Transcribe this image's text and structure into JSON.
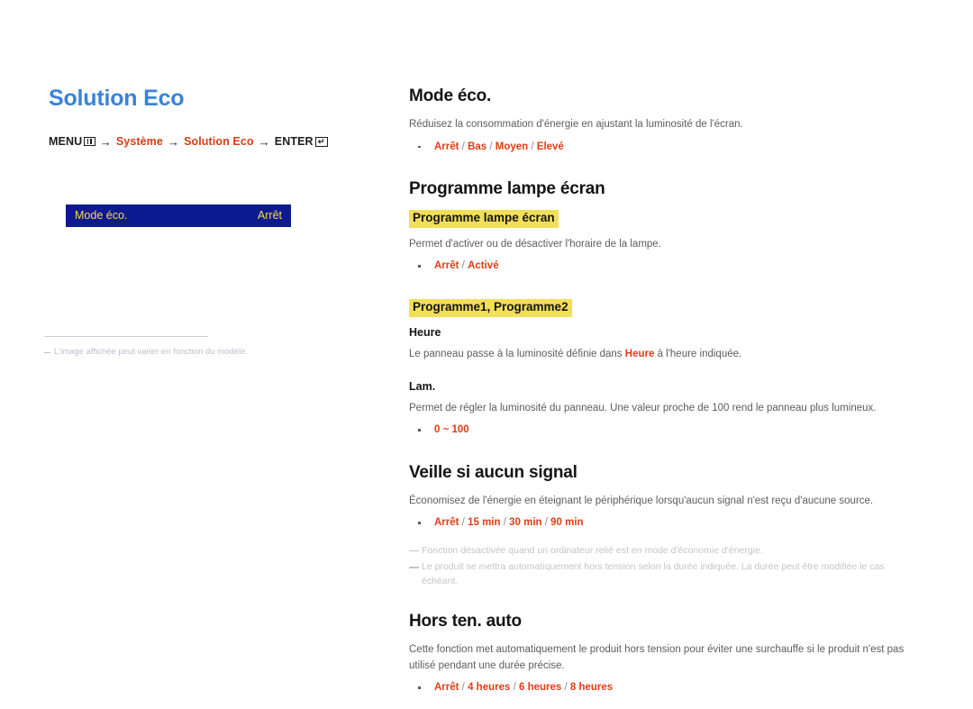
{
  "page": {
    "title": "Solution Eco"
  },
  "breadcrumb": {
    "menu_label": "MENU",
    "menu_icon": "menu-grid-icon",
    "arrow": "→",
    "step1": "Système",
    "step2": "Solution Eco",
    "enter_label": "ENTER",
    "enter_icon": "enter-return-icon",
    "enter_glyph": "↵"
  },
  "osd": {
    "label": "Mode éco.",
    "value": "Arrêt",
    "bg_color": "#0d1a8f",
    "text_color": "#ffd94a"
  },
  "left_note": {
    "text": "L'image affichée peut varier en fonction du modèle."
  },
  "colors": {
    "title_blue": "#3b82d8",
    "accent_orange": "#e03c16",
    "highlight_yellow": "#f2df58",
    "body_gray": "#5c5c5c"
  },
  "sections": [
    {
      "title": "Mode éco.",
      "body": "Réduisez la consommation d'énergie en ajustant la luminosité de l'écran.",
      "options": [
        "Arrêt",
        "Bas",
        "Moyen",
        "Elevé"
      ]
    },
    {
      "title": "Programme lampe écran",
      "highlight_head_1": "Programme lampe écran",
      "body_1": "Permet d'activer ou de désactiver l'horaire de la lampe.",
      "options_1": [
        "Arrêt",
        "Activé"
      ],
      "highlight_head_2": "Programme1, Programme2",
      "sub_head_1": "Heure",
      "body_2_pre": "Le panneau passe à la luminosité définie dans ",
      "body_2_hl": "Heure",
      "body_2_post": " à l'heure indiquée.",
      "sub_head_2": "Lam.",
      "body_3": "Permet de régler la luminosité du panneau. Une valeur proche de 100 rend le panneau plus lumineux.",
      "options_2": [
        "0 ~ 100"
      ]
    },
    {
      "title": "Veille si aucun signal",
      "body": "Économisez de l'énergie en éteignant le périphérique lorsqu'aucun signal n'est reçu d'aucune source.",
      "options": [
        "Arrêt",
        "15 min",
        "30 min",
        "90 min"
      ],
      "notes": [
        "Fonction désactivée quand un ordinateur relié est en mode d'économie d'énergie.",
        "Le produit se mettra automatiquement hors tension selon la durée indiquée. La durée peut être modifiée le cas échéant."
      ]
    },
    {
      "title": "Hors ten. auto",
      "body": "Cette fonction met automatiquement le produit hors tension pour éviter une surchauffe si le produit n'est pas utilisé pendant une durée précise.",
      "options": [
        "Arrêt",
        "4 heures",
        "6 heures",
        "8 heures"
      ]
    }
  ]
}
